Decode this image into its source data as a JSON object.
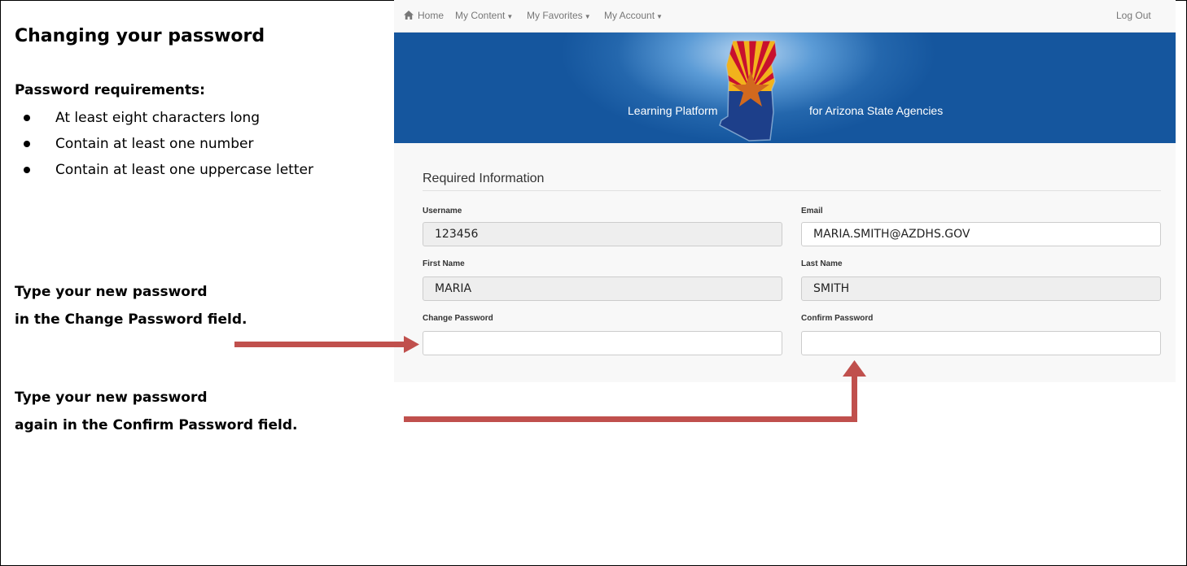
{
  "instructions": {
    "title": "Changing your password",
    "requirements_heading": "Password requirements:",
    "requirements": [
      "At least eight characters long",
      "Contain at least one number",
      "Contain at least one uppercase letter"
    ],
    "step1_line1": "Type your new password",
    "step1_line2": "in the Change Password field.",
    "step2_line1": "Type your new password",
    "step2_line2": "again in the Confirm Password field."
  },
  "navbar": {
    "home": "Home",
    "my_content": "My Content",
    "my_favorites": "My Favorites",
    "my_account": "My Account",
    "log_out": "Log Out"
  },
  "banner": {
    "left_text": "Learning Platform",
    "right_text": "for Arizona State Agencies"
  },
  "form": {
    "section_title": "Required Information",
    "username_label": "Username",
    "username_value": "123456",
    "email_label": "Email",
    "email_value": "MARIA.SMITH@AZDHS.GOV",
    "first_name_label": "First Name",
    "first_name_value": "MARIA",
    "last_name_label": "Last Name",
    "last_name_value": "SMITH",
    "change_password_label": "Change Password",
    "change_password_value": "",
    "confirm_password_label": "Confirm Password",
    "confirm_password_value": ""
  },
  "colors": {
    "arrow": "#c0504d",
    "banner_blue": "#15569e",
    "az_red": "#c8102e",
    "az_gold": "#f2b21c",
    "az_copper": "#d2691e"
  },
  "icons": [
    "home-icon",
    "caret-down-icon",
    "arizona-flag-logo",
    "arrow-right-icon",
    "arrow-up-icon"
  ]
}
